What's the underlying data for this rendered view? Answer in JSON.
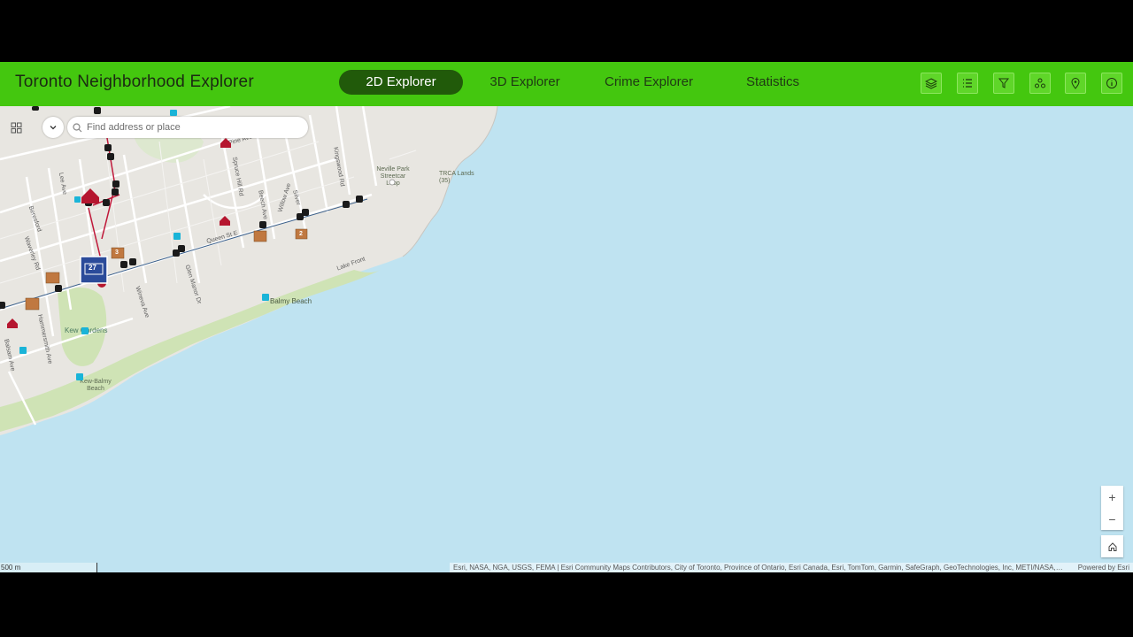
{
  "header": {
    "title": "Toronto Neighborhood Explorer",
    "tabs": [
      {
        "label": "2D Explorer",
        "active": true
      },
      {
        "label": "3D Explorer",
        "active": false
      },
      {
        "label": "Crime Explorer",
        "active": false
      },
      {
        "label": "Statistics",
        "active": false
      }
    ],
    "tools": [
      {
        "name": "layers-icon"
      },
      {
        "name": "legend-list-icon"
      },
      {
        "name": "filter-icon"
      },
      {
        "name": "share-icon"
      },
      {
        "name": "location-pin-icon"
      },
      {
        "name": "info-icon"
      }
    ]
  },
  "search": {
    "placeholder": "Find address or place"
  },
  "map": {
    "streets": [
      "Pine Ave",
      "Spruce Hill Rd",
      "Beech Ave",
      "Willow Ave",
      "Silver",
      "Kingswood Rd",
      "Glen Manor Dr",
      "Wineva Ave",
      "Lee Ave",
      "Beresford",
      "Waverley Rd",
      "Hammersmith Ave",
      "Balsam Ave",
      "Queen St E",
      "Lake Front"
    ],
    "places": [
      "Neville Park Streetcar Loop",
      "TRCA Lands (35)",
      "Balmy Beach",
      "Kew Gardens",
      "Kew-Balmy Beach"
    ],
    "badges": [
      "2",
      "3",
      "27"
    ],
    "zoom_in": "+",
    "zoom_out": "−"
  },
  "footer": {
    "scale_label": "500 m",
    "attribution": "Esri, NASA, NGA, USGS, FEMA | Esri Community Maps Contributors, City of Toronto, Province of Ontario, Esri Canada, Esri, TomTom, Garmin, SafeGraph, GeoTechnologies, Inc, METI/NASA, USGS, EPA, NPS, US Census Bureau, USDA, AAFC, NRCan",
    "powered_by": "Powered by Esri"
  },
  "colors": {
    "header_bg": "#44c70f",
    "active_tab": "#215a0a",
    "water": "#bfe3f1",
    "land": "#e8e6e1",
    "park": "#cfe3b5"
  }
}
